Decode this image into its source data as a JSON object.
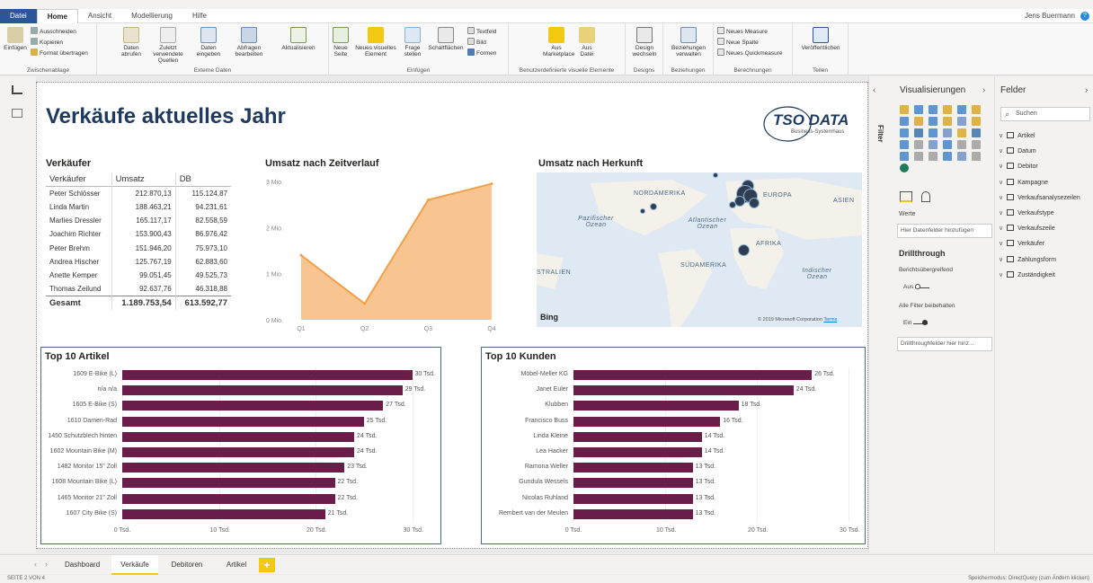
{
  "ribbon_tabs": [
    "Datei",
    "Home",
    "Ansicht",
    "Modellierung",
    "Hilfe"
  ],
  "user": "Jens Buermann",
  "ribbon": {
    "einfuegen": "Einfügen",
    "ausschneiden": "Ausschneiden",
    "kopieren": "Kopieren",
    "format": "Format übertragen",
    "zwischenablage": "Zwischenablage",
    "daten_abrufen": "Daten abrufen",
    "zuletzt": "Zuletzt verwendete Quellen",
    "daten_eingeben": "Daten eingeben",
    "abfragen": "Abfragen bearbeiten",
    "aktualisieren": "Aktualisieren",
    "externe_daten": "Externe Daten",
    "neue_seite": "Neue Seite",
    "neues_visuelles": "Neues visuelles Element",
    "frage": "Frage stellen",
    "schaltflaechen": "Schaltflächen",
    "textfeld": "Textfeld",
    "bild": "Bild",
    "formen": "Formen",
    "einfuegen_grp": "Einfügen",
    "marketplace": "Aus Marketplace",
    "datei": "Aus Datei",
    "benutzer": "Benutzerdefinierte visuelle Elemente",
    "design": "Design wechseln",
    "designs": "Designs",
    "beziehungen_verwalten": "Beziehungen verwalten",
    "beziehungen": "Beziehungen",
    "measure": "Neues Measure",
    "spalte": "Neue Spalte",
    "quickmeasure": "Neues Quickmeasure",
    "berechnungen": "Berechnungen",
    "veroeffentlichen": "Veröffentlichen",
    "teilen": "Teilen"
  },
  "report": {
    "title": "Verkäufe aktuelles Jahr",
    "logo_main": "TSO DATA",
    "logo_sub": "Business-Systemhaus",
    "sales_table": {
      "title": "Verkäufer",
      "headers": [
        "Verkäufer",
        "Umsatz",
        "DB"
      ],
      "rows": [
        [
          "Peter Schlösser",
          "212.870,13",
          "115.124,87"
        ],
        [
          "Linda Martin",
          "188.463,21",
          "94.231,61"
        ],
        [
          "Marlies Dressler",
          "165.117,17",
          "82.558,59"
        ],
        [
          "Joachim Richter",
          "153.900,43",
          "86.976,42"
        ],
        [
          "Peter Brehm",
          "151.946,20",
          "75.973,10"
        ],
        [
          "Andrea Hischer",
          "125.767,19",
          "62.883,60"
        ],
        [
          "Anette Kemper",
          "99.051,45",
          "49.525,73"
        ],
        [
          "Thomas Zeilund",
          "92.637,76",
          "46.318,88"
        ]
      ],
      "total": [
        "Gesamt",
        "1.189.753,54",
        "613.592,77"
      ]
    },
    "area_title": "Umsatz nach Zeitverlauf",
    "map": {
      "title": "Umsatz nach Herkunft",
      "nordamerika": "NORDAMERIKA",
      "europa": "EUROPA",
      "asien": "ASIEN",
      "pazifischer": "Pazifischer Ozean",
      "atlantischer": "Atlantischer Ozean",
      "afrika": "AFRIKA",
      "suedamerika": "SÜDAMERIKA",
      "australien": "STRALIEN",
      "indischer": "Indischer Ozean",
      "bing": "Bing",
      "copyright": "© 2019 Microsoft Corporation",
      "terms": "Terms"
    }
  },
  "chart_data": [
    {
      "type": "area",
      "title": "Umsatz nach Zeitverlauf",
      "categories": [
        "Q1",
        "Q2",
        "Q3",
        "Q4"
      ],
      "values": [
        1.4,
        0.35,
        2.6,
        2.95
      ],
      "ylim": [
        0,
        3
      ],
      "yticks": [
        "0 Mio.",
        "1 Mio.",
        "2 Mio.",
        "3 Mio."
      ],
      "yunit": "Mio.",
      "color": "#f5b26b",
      "line_color": "#f0a04b"
    },
    {
      "type": "bar",
      "orientation": "horizontal",
      "title": "Top 10 Artikel",
      "categories": [
        "1609 E-Bike (L)",
        "n/a n/a",
        "1605 E-Bike (S)",
        "1610 Damen-Rad",
        "1450 Schutzblech hinten",
        "1602 Mountain Bike (M)",
        "1482 Monitor 15\" Zoll",
        "1608 Mountain Bike (L)",
        "1465 Monitor 21\" Zoll",
        "1607 City Bike (S)"
      ],
      "values": [
        30,
        29,
        27,
        25,
        24,
        24,
        23,
        22,
        22,
        21
      ],
      "xlim": [
        0,
        32
      ],
      "xticks": [
        0,
        10,
        20,
        30
      ],
      "unit": "Tsd.",
      "color": "#6b1d49"
    },
    {
      "type": "bar",
      "orientation": "horizontal",
      "title": "Top 10 Kunden",
      "categories": [
        "Möbel-Meller KG",
        "Janet Euler",
        "Klubben",
        "Francisco Buss",
        "Linda Kleine",
        "Lea Hacker",
        "Ramona Weller",
        "Gundula Wessels",
        "Nicolas Ruhland",
        "Rembert van der Meulen"
      ],
      "values": [
        26,
        24,
        18,
        16,
        14,
        14,
        13,
        13,
        13,
        13
      ],
      "xlim": [
        0,
        30
      ],
      "xticks": [
        0,
        10,
        20,
        30
      ],
      "unit": "Tsd.",
      "color": "#6b1d49"
    }
  ],
  "vispane": {
    "title": "Visualisierungen",
    "filter": "Filter",
    "werte": "Werte",
    "placeholder": "Hier Datenfelder hinzufügen",
    "drillthrough": "Drillthrough",
    "berichts": "Berichtsübergreifend",
    "aus": "Aus",
    "alle": "Alle Filter beibehalten",
    "ein": "Ein",
    "drillfields": "Drillthroughfelder hier hinz..."
  },
  "fieldpane": {
    "title": "Felder",
    "search": "Suchen",
    "fields": [
      "Artikel",
      "Datum",
      "Debitor",
      "Kampagne",
      "Verkaufsanalysezeilen",
      "Verkaufstype",
      "Verkaufszeile",
      "Verkäufer",
      "Zahlungsform",
      "Zuständigkeit"
    ]
  },
  "pages": [
    "Dashboard",
    "Verkäufe",
    "Debitoren",
    "Artikel"
  ],
  "status": {
    "left": "SEITE 2 VON 4",
    "right": "Speichermodus: DirectQuery (zum Ändern klicken)"
  }
}
